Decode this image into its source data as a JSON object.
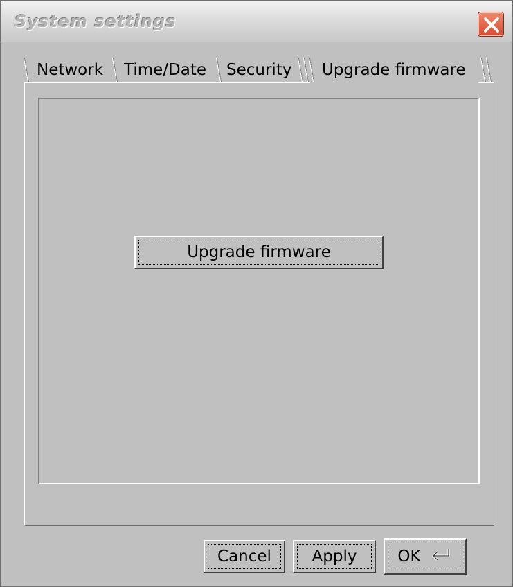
{
  "window": {
    "title": "System settings"
  },
  "tabs": [
    {
      "label": "Network",
      "active": false
    },
    {
      "label": "Time/Date",
      "active": false
    },
    {
      "label": "Security",
      "active": false
    },
    {
      "label": "Upgrade firmware",
      "active": true
    }
  ],
  "panel": {
    "upgrade_button_label": "Upgrade firmware"
  },
  "footer": {
    "cancel_label": "Cancel",
    "apply_label": "Apply",
    "ok_label": "OK",
    "ok_icon": "enter-icon"
  },
  "colors": {
    "window_bg": "#c0c0c0",
    "close_button": "#d8492e"
  }
}
